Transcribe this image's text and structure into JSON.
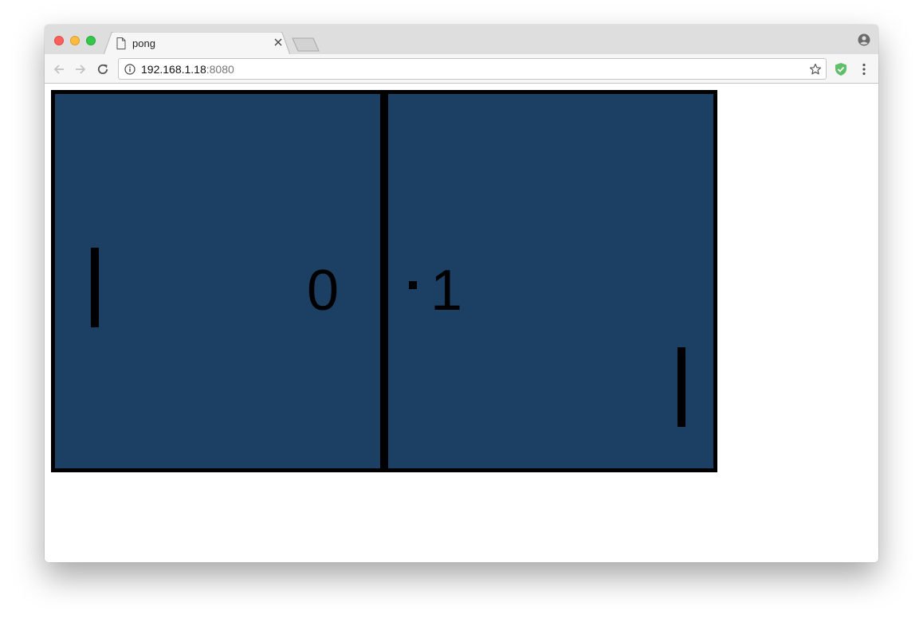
{
  "browser": {
    "tab": {
      "title": "pong",
      "icon": "document-icon",
      "close_icon": "close-icon"
    },
    "address_bar": {
      "host": "192.168.1.18",
      "port": ":8080",
      "info_icon": "info-icon",
      "bookmark_icon": "star-icon"
    },
    "toolbar": {
      "back_icon": "back-arrow-icon",
      "forward_icon": "forward-arrow-icon",
      "reload_icon": "reload-icon",
      "extension_icon": "shield-check-icon",
      "menu_icon": "vertical-ellipsis-icon",
      "profile_icon": "account-circle-icon"
    }
  },
  "game": {
    "left_score": "0",
    "right_score": "1",
    "colors": {
      "court": "#1c4064",
      "lines": "#000000",
      "paddles": "#000000",
      "ball": "#000000"
    }
  }
}
